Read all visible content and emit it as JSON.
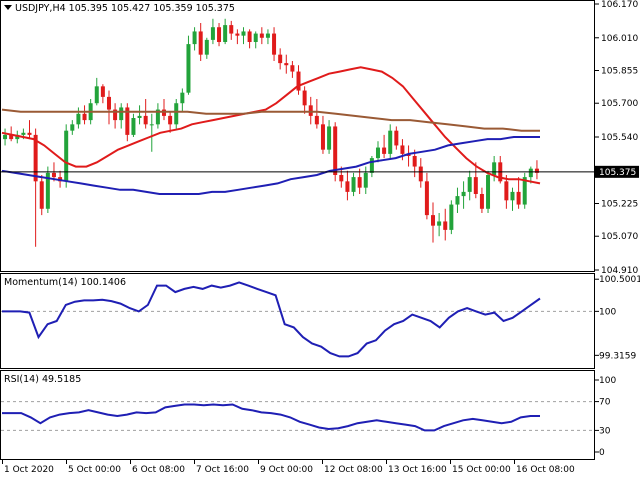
{
  "header": {
    "symbol": "USDJPY,H4",
    "open": "105.395",
    "high": "105.427",
    "low": "105.359",
    "close": "105.375"
  },
  "momentum": {
    "label": "Momentum(14)",
    "value": "100.1406",
    "levels": [
      "100.5001",
      "100",
      "99.3159"
    ]
  },
  "rsi": {
    "label": "RSI(14)",
    "value": "49.5185",
    "levels": [
      "100",
      "70",
      "30",
      "0"
    ]
  },
  "price_axis": [
    "106.170",
    "106.010",
    "105.855",
    "105.700",
    "105.540",
    "105.375",
    "105.225",
    "105.070",
    "104.910"
  ],
  "current_price_tag": "105.375",
  "time_axis": [
    "1 Oct 2020",
    "5 Oct 00:00",
    "6 Oct 08:00",
    "7 Oct 16:00",
    "9 Oct 00:00",
    "12 Oct 08:00",
    "13 Oct 16:00",
    "15 Oct 00:00",
    "16 Oct 08:00"
  ],
  "colors": {
    "bull": "#22a33a",
    "bear": "#e01b1b",
    "ma_fast": "#e01b1b",
    "ma_mid": "#1f1fb4",
    "ma_slow": "#9a5a35",
    "indicator": "#1f1fb4",
    "grid": "#a0a0a0"
  },
  "chart_data": [
    {
      "type": "candlestick",
      "title": "USDJPY,H4",
      "ylim": [
        104.91,
        106.17
      ],
      "x": [
        "1 Oct 2020",
        "5 Oct 00:00",
        "6 Oct 08:00",
        "7 Oct 16:00",
        "9 Oct 00:00",
        "12 Oct 08:00",
        "13 Oct 16:00",
        "15 Oct 00:00",
        "16 Oct 08:00"
      ],
      "candles": [
        [
          105.53,
          105.58,
          105.5,
          105.55
        ],
        [
          105.55,
          105.59,
          105.52,
          105.53
        ],
        [
          105.53,
          105.57,
          105.51,
          105.55
        ],
        [
          105.55,
          105.58,
          105.53,
          105.56
        ],
        [
          105.56,
          105.62,
          105.53,
          105.55
        ],
        [
          105.55,
          105.58,
          105.02,
          105.33
        ],
        [
          105.33,
          105.36,
          105.17,
          105.2
        ],
        [
          105.2,
          105.4,
          105.18,
          105.37
        ],
        [
          105.37,
          105.42,
          105.33,
          105.35
        ],
        [
          105.35,
          105.38,
          105.3,
          105.33
        ],
        [
          105.33,
          105.6,
          105.3,
          105.57
        ],
        [
          105.57,
          105.62,
          105.55,
          105.6
        ],
        [
          105.6,
          105.68,
          105.58,
          105.65
        ],
        [
          105.65,
          105.69,
          105.6,
          105.62
        ],
        [
          105.62,
          105.72,
          105.6,
          105.7
        ],
        [
          105.7,
          105.82,
          105.69,
          105.78
        ],
        [
          105.78,
          105.79,
          105.7,
          105.73
        ],
        [
          105.73,
          105.76,
          105.6,
          105.67
        ],
        [
          105.67,
          105.7,
          105.58,
          105.62
        ],
        [
          105.62,
          105.7,
          105.58,
          105.68
        ],
        [
          105.68,
          105.7,
          105.52,
          105.55
        ],
        [
          105.55,
          105.65,
          105.54,
          105.63
        ],
        [
          105.63,
          105.69,
          105.6,
          105.64
        ],
        [
          105.64,
          105.72,
          105.58,
          105.6
        ],
        [
          105.6,
          105.65,
          105.47,
          105.6
        ],
        [
          105.6,
          105.7,
          105.58,
          105.67
        ],
        [
          105.67,
          105.72,
          105.62,
          105.64
        ],
        [
          105.64,
          105.66,
          105.56,
          105.6
        ],
        [
          105.6,
          105.72,
          105.58,
          105.7
        ],
        [
          105.7,
          105.77,
          105.66,
          105.75
        ],
        [
          105.75,
          106.02,
          105.74,
          105.98
        ],
        [
          105.98,
          106.06,
          105.95,
          106.04
        ],
        [
          106.04,
          106.08,
          105.9,
          105.93
        ],
        [
          105.93,
          106.01,
          105.91,
          106.0
        ],
        [
          106.0,
          106.1,
          105.98,
          106.06
        ],
        [
          106.06,
          106.08,
          105.97,
          105.99
        ],
        [
          105.99,
          106.1,
          105.98,
          106.07
        ],
        [
          106.07,
          106.09,
          106.0,
          106.03
        ],
        [
          106.03,
          106.05,
          105.98,
          106.02
        ],
        [
          106.02,
          106.06,
          105.98,
          106.04
        ],
        [
          106.04,
          106.05,
          105.96,
          105.99
        ],
        [
          105.99,
          106.04,
          105.96,
          106.03
        ],
        [
          106.03,
          106.06,
          105.98,
          106.01
        ],
        [
          106.01,
          106.05,
          105.98,
          106.03
        ],
        [
          106.03,
          106.06,
          105.9,
          105.93
        ],
        [
          105.93,
          105.96,
          105.86,
          105.89
        ],
        [
          105.89,
          105.93,
          105.84,
          105.88
        ],
        [
          105.88,
          105.9,
          105.82,
          105.85
        ],
        [
          105.85,
          105.88,
          105.74,
          105.76
        ],
        [
          105.76,
          105.78,
          105.65,
          105.69
        ],
        [
          105.69,
          105.73,
          105.6,
          105.64
        ],
        [
          105.64,
          105.72,
          105.58,
          105.6
        ],
        [
          105.6,
          105.64,
          105.46,
          105.48
        ],
        [
          105.48,
          105.62,
          105.46,
          105.59
        ],
        [
          105.59,
          105.61,
          105.33,
          105.36
        ],
        [
          105.36,
          105.4,
          105.3,
          105.33
        ],
        [
          105.33,
          105.38,
          105.24,
          105.28
        ],
        [
          105.28,
          105.37,
          105.26,
          105.35
        ],
        [
          105.35,
          105.39,
          105.27,
          105.3
        ],
        [
          105.3,
          105.4,
          105.27,
          105.37
        ],
        [
          105.37,
          105.45,
          105.35,
          105.44
        ],
        [
          105.44,
          105.52,
          105.42,
          105.49
        ],
        [
          105.49,
          105.55,
          105.44,
          105.46
        ],
        [
          105.46,
          105.6,
          105.44,
          105.57
        ],
        [
          105.57,
          105.59,
          105.48,
          105.5
        ],
        [
          105.5,
          105.53,
          105.43,
          105.46
        ],
        [
          105.46,
          105.5,
          105.4,
          105.45
        ],
        [
          105.45,
          105.48,
          105.35,
          105.4
        ],
        [
          105.4,
          105.44,
          105.3,
          105.33
        ],
        [
          105.33,
          105.37,
          105.15,
          105.17
        ],
        [
          105.17,
          105.23,
          105.04,
          105.12
        ],
        [
          105.12,
          105.18,
          105.07,
          105.14
        ],
        [
          105.14,
          105.2,
          105.05,
          105.1
        ],
        [
          105.1,
          105.24,
          105.08,
          105.22
        ],
        [
          105.22,
          105.3,
          105.18,
          105.26
        ],
        [
          105.26,
          105.33,
          105.2,
          105.28
        ],
        [
          105.28,
          105.38,
          105.24,
          105.35
        ],
        [
          105.35,
          105.42,
          105.25,
          105.27
        ],
        [
          105.27,
          105.3,
          105.18,
          105.2
        ],
        [
          105.2,
          105.38,
          105.18,
          105.36
        ],
        [
          105.36,
          105.45,
          105.33,
          105.42
        ],
        [
          105.42,
          105.45,
          105.32,
          105.33
        ],
        [
          105.33,
          105.36,
          105.2,
          105.24
        ],
        [
          105.24,
          105.3,
          105.19,
          105.28
        ],
        [
          105.28,
          105.35,
          105.2,
          105.22
        ],
        [
          105.22,
          105.37,
          105.2,
          105.35
        ],
        [
          105.35,
          105.4,
          105.32,
          105.39
        ],
        [
          105.39,
          105.43,
          105.34,
          105.37
        ]
      ],
      "series": [
        {
          "values": [
            105.56,
            105.55,
            105.54,
            105.53,
            105.5,
            105.46,
            105.42,
            105.4,
            105.4,
            105.42,
            105.45,
            105.48,
            105.5,
            105.52,
            105.54,
            105.56,
            105.57,
            105.58,
            105.6,
            105.61,
            105.62,
            105.63,
            105.64,
            105.65,
            105.66,
            105.67,
            105.7,
            105.74,
            105.78,
            105.8,
            105.82,
            105.84,
            105.85,
            105.86,
            105.87,
            105.86,
            105.85,
            105.82,
            105.78,
            105.72,
            105.66,
            105.6,
            105.54,
            105.49,
            105.44,
            105.4,
            105.37,
            105.35,
            105.34,
            105.34,
            105.33,
            105.32
          ]
        },
        {
          "values": [
            105.38,
            105.37,
            105.36,
            105.35,
            105.34,
            105.33,
            105.32,
            105.31,
            105.3,
            105.29,
            105.29,
            105.28,
            105.27,
            105.27,
            105.27,
            105.27,
            105.28,
            105.28,
            105.29,
            105.3,
            105.31,
            105.32,
            105.34,
            105.35,
            105.36,
            105.38,
            105.39,
            105.4,
            105.42,
            105.43,
            105.44,
            105.46,
            105.47,
            105.48,
            105.5,
            105.51,
            105.52,
            105.53,
            105.53,
            105.54,
            105.54,
            105.54
          ]
        },
        {
          "values": [
            105.67,
            105.66,
            105.66,
            105.66,
            105.66,
            105.66,
            105.66,
            105.66,
            105.66,
            105.66,
            105.66,
            105.65,
            105.65,
            105.65,
            105.66,
            105.66,
            105.66,
            105.66,
            105.65,
            105.64,
            105.63,
            105.62,
            105.62,
            105.61,
            105.6,
            105.59,
            105.58,
            105.58,
            105.57,
            105.57
          ]
        }
      ]
    },
    {
      "type": "line",
      "title": "Momentum(14) 100.1406",
      "ylim": [
        99.15,
        100.55
      ],
      "series": [
        {
          "values": [
            100.0,
            100.0,
            100.0,
            99.98,
            99.6,
            99.8,
            99.85,
            100.1,
            100.15,
            100.17,
            100.17,
            100.18,
            100.16,
            100.12,
            100.05,
            100.0,
            100.1,
            100.4,
            100.4,
            100.3,
            100.35,
            100.38,
            100.35,
            100.4,
            100.37,
            100.4,
            100.45,
            100.4,
            100.35,
            100.3,
            100.25,
            99.8,
            99.75,
            99.6,
            99.5,
            99.45,
            99.35,
            99.3,
            99.3,
            99.35,
            99.5,
            99.55,
            99.7,
            99.8,
            99.85,
            99.95,
            99.9,
            99.85,
            99.75,
            99.9,
            100.0,
            100.05,
            100.0,
            99.95,
            99.98,
            99.85,
            99.9,
            100.0,
            100.1,
            100.2
          ]
        }
      ]
    },
    {
      "type": "line",
      "title": "RSI(14) 49.5185",
      "ylim": [
        0,
        100
      ],
      "series": [
        {
          "values": [
            54,
            54,
            54,
            48,
            40,
            48,
            52,
            54,
            55,
            58,
            55,
            52,
            50,
            52,
            55,
            54,
            55,
            62,
            64,
            66,
            66,
            65,
            66,
            65,
            66,
            60,
            58,
            55,
            54,
            52,
            48,
            42,
            38,
            34,
            32,
            33,
            36,
            40,
            42,
            44,
            42,
            40,
            38,
            36,
            30,
            30,
            36,
            40,
            44,
            46,
            44,
            42,
            40,
            42,
            48,
            50,
            50
          ]
        }
      ]
    }
  ]
}
